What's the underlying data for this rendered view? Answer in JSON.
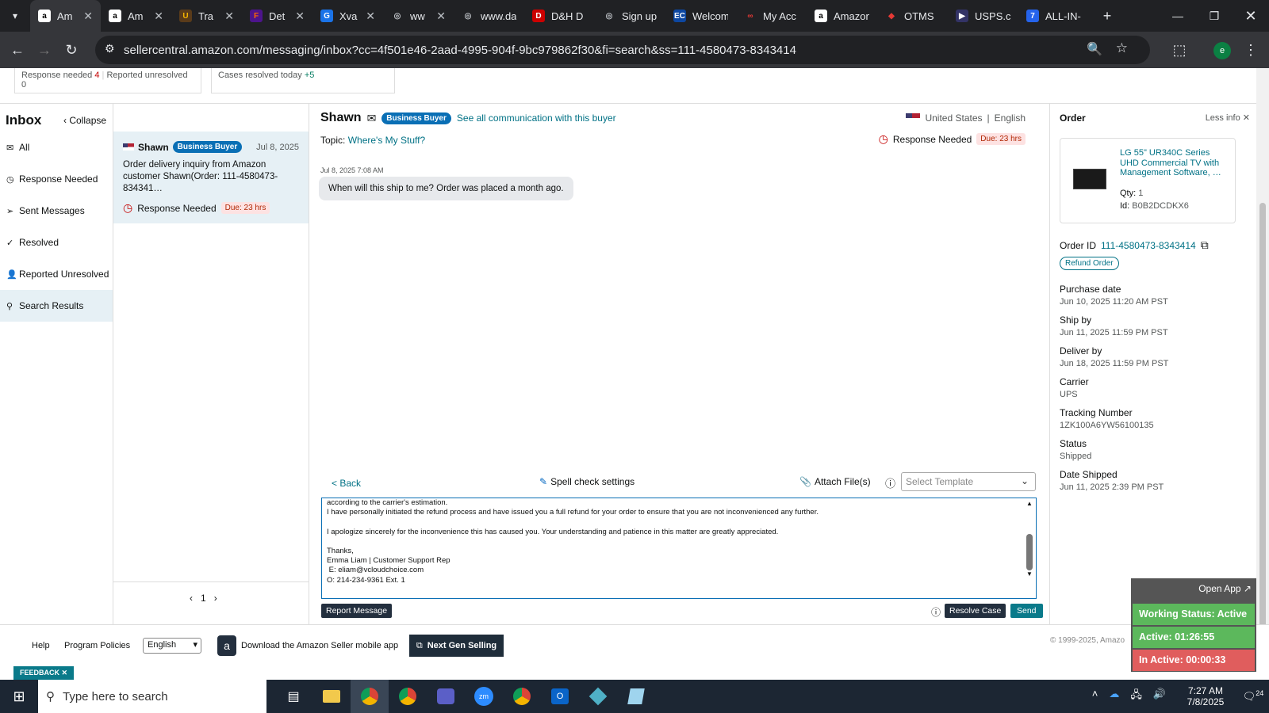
{
  "browser": {
    "tabs": [
      {
        "label": "Am",
        "icon": "amazon-icon",
        "active": true
      },
      {
        "label": "Am",
        "icon": "amazon-icon"
      },
      {
        "label": "Tra",
        "icon": "ups-icon"
      },
      {
        "label": "Det",
        "icon": "fedex-icon"
      },
      {
        "label": "Xva",
        "icon": "g-icon"
      },
      {
        "label": "ww",
        "icon": "globe-icon"
      },
      {
        "label": "www.da",
        "icon": "globe-icon"
      },
      {
        "label": "D&H D",
        "icon": "dh-icon"
      },
      {
        "label": "Sign up",
        "icon": "globe-icon"
      },
      {
        "label": "Welcom",
        "icon": "ec-icon"
      },
      {
        "label": "My Acc",
        "icon": "account-icon"
      },
      {
        "label": "Amazon",
        "icon": "amazon-icon"
      },
      {
        "label": "OTMS",
        "icon": "otms-icon"
      },
      {
        "label": "USPS.co",
        "icon": "usps-icon"
      },
      {
        "label": "ALL-IN-",
        "icon": "t7-icon"
      }
    ],
    "url": "sellercentral.amazon.com/messaging/inbox?cc=4f501e46-2aad-4995-904f-9bc979862f30&fi=search&ss=111-4580473-8343414",
    "profile_initial": "e"
  },
  "header_cards": {
    "response_needed_label": "Response needed",
    "response_needed_count": "4",
    "reported_unresolved_label": "Reported unresolved",
    "reported_unresolved_count": "0",
    "cases_resolved_label": "Cases resolved today",
    "cases_resolved_count": "+5"
  },
  "nav": {
    "title": "Inbox",
    "collapse": "Collapse",
    "items": [
      "All",
      "Response Needed",
      "Sent Messages",
      "Resolved",
      "Reported Unresolved",
      "Search Results"
    ]
  },
  "thread": {
    "name": "Shawn",
    "badge": "Business Buyer",
    "date": "Jul 8, 2025",
    "preview": "Order delivery inquiry from Amazon customer Shawn(Order: 111-4580473-834341…",
    "status": "Response Needed",
    "due": "Due: 23 hrs",
    "page": "1"
  },
  "conversation": {
    "buyer": "Shawn",
    "badge": "Business Buyer",
    "see_all": "See all communication with this buyer",
    "country": "United States",
    "language": "English",
    "topic_label": "Topic:",
    "topic": "Where's My Stuff?",
    "status": "Response Needed",
    "due": "Due: 23 hrs",
    "msg_time": "Jul 8, 2025 7:08 AM",
    "msg": "When will this ship to me? Order was placed a month ago.",
    "back": "< Back",
    "spell": "Spell check settings",
    "attach": "Attach File(s)",
    "template_placeholder": "Select Template",
    "reply_lines": [
      "according to the carrier's estimation.",
      "I have personally initiated the refund process and have issued you a full refund for your order to ensure that you are not inconvenienced any further.",
      "",
      "I apologize sincerely for the inconvenience this has caused you. Your understanding and patience in this matter are greatly appreciated.",
      "",
      "Thanks,",
      "Emma Liam | Customer Support Rep",
      " E: eliam@vcloudchoice.com",
      "O: 214-234-9361 Ext. 1"
    ],
    "report": "Report Message",
    "resolve": "Resolve Case",
    "send": "Send"
  },
  "order": {
    "title": "Order",
    "less_info": "Less info",
    "product": "LG 55\" UR340C Series UHD Commercial TV with Management Software, …",
    "qty_label": "Qty:",
    "qty": "1",
    "id_label": "Id:",
    "id": "B0B2DCDKX6",
    "order_id_label": "Order ID",
    "order_id": "111-4580473-8343414",
    "refund": "Refund Order",
    "fields": [
      {
        "label": "Purchase date",
        "value": "Jun 10, 2025 11:20 AM PST"
      },
      {
        "label": "Ship by",
        "value": "Jun 11, 2025 11:59 PM PST"
      },
      {
        "label": "Deliver by",
        "value": "Jun 18, 2025 11:59 PM PST"
      },
      {
        "label": "Carrier",
        "value": "UPS"
      },
      {
        "label": "Tracking Number",
        "value": "1ZK100A6YW56100135"
      },
      {
        "label": "Status",
        "value": "Shipped"
      },
      {
        "label": "Date Shipped",
        "value": "Jun 11, 2025 2:39 PM PST"
      }
    ]
  },
  "footer": {
    "help": "Help",
    "policies": "Program Policies",
    "language": "English",
    "mobile": "Download the Amazon Seller mobile app",
    "nextgen": "Next Gen Selling",
    "copyright": "© 1999-2025, Amazo",
    "feedback": "FEEDBACK"
  },
  "widget": {
    "open_app": "Open App ↗",
    "working": "Working Status: Active",
    "active": "Active: 01:26:55",
    "inactive": "In Active: 00:00:33",
    "colors": {
      "working": "#5cb85c",
      "active": "#5cb85c",
      "inactive": "#e05d5d"
    }
  },
  "taskbar": {
    "search": "Type here to search",
    "time": "7:27 AM",
    "date": "7/8/2025",
    "notif": "24"
  }
}
